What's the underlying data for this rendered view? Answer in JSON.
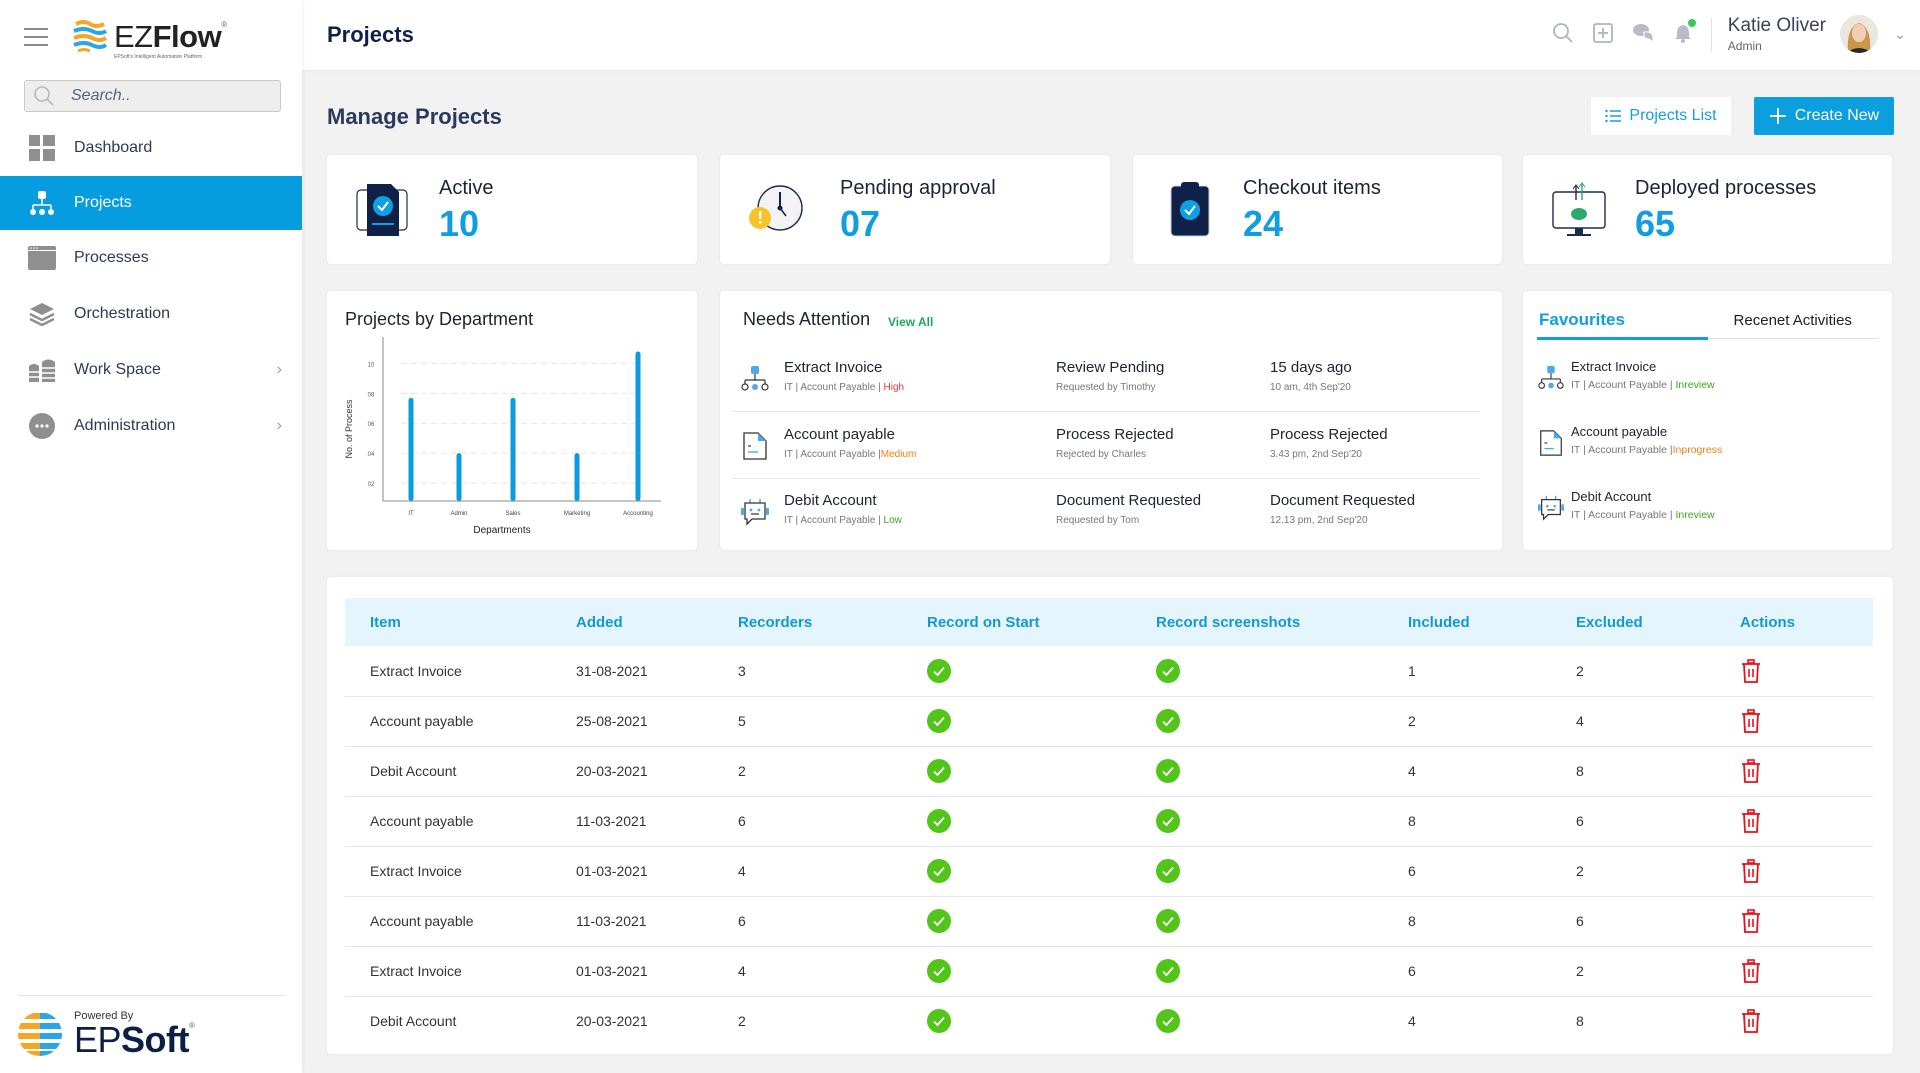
{
  "app": {
    "logo_text_light": "EZ",
    "logo_text_bold": "Flow",
    "logo_tagline": "EPSoft's Intelligent Automation Platform",
    "powered_by": "Powered By",
    "powered_brand_light": "EP",
    "powered_brand_bold": "Soft"
  },
  "sidebar": {
    "search_placeholder": "Search..",
    "items": [
      {
        "label": "Dashboard",
        "icon": "dashboard-icon",
        "active": false
      },
      {
        "label": "Projects",
        "icon": "hierarchy-icon",
        "active": true
      },
      {
        "label": "Processes",
        "icon": "browser-window-icon",
        "active": false
      },
      {
        "label": "Orchestration",
        "icon": "layers-icon",
        "active": false
      },
      {
        "label": "Work Space",
        "icon": "workspace-icon",
        "active": false,
        "has_submenu": true
      },
      {
        "label": "Administration",
        "icon": "more-circle-icon",
        "active": false,
        "has_submenu": true
      }
    ]
  },
  "header": {
    "title": "Projects",
    "icons": [
      "search-icon",
      "add-box-icon",
      "chat-icon",
      "bell-icon"
    ],
    "user_name": "Katie Oliver",
    "user_role": "Admin"
  },
  "main": {
    "section_title": "Manage Projects",
    "projects_list_label": "Projects List",
    "create_new_label": "Create New",
    "stats": [
      {
        "label": "Active",
        "value": "10"
      },
      {
        "label": "Pending approval",
        "value": "07"
      },
      {
        "label": "Checkout items",
        "value": "24"
      },
      {
        "label": "Deployed processes",
        "value": "65"
      }
    ]
  },
  "chart_data": {
    "type": "bar",
    "title": "Projects by Department",
    "xlabel": "Departments",
    "ylabel": "No. of Process",
    "categories": [
      "IT",
      "Admin",
      "Sales",
      "Marketing",
      "Accounting"
    ],
    "values": [
      7.7,
      4,
      7.7,
      4,
      10.8
    ],
    "yticks": [
      "02",
      "04",
      "06",
      "08",
      "10"
    ],
    "ytick_values": [
      2,
      4,
      6,
      8,
      10
    ],
    "ylim": [
      0.8,
      11.5
    ],
    "grid": true,
    "bar_color": "#0a9be0"
  },
  "needs_attention": {
    "title": "Needs Attention",
    "view_all": "View All",
    "items": [
      {
        "name": "Extract Invoice",
        "dept": "IT",
        "category": "Account Payable",
        "priority": "High",
        "priority_class": "pr-high",
        "status": "Review Pending",
        "by": "Requested by Timothy",
        "when": "15 days ago",
        "date": "10 am, 4th Sep'20",
        "icon": "hierarchy-icon"
      },
      {
        "name": "Account payable",
        "dept": "IT",
        "category": "Account Payable",
        "priority": "Medium",
        "priority_class": "pr-medium",
        "status": "Process Rejected",
        "by": "Rejected by Charles",
        "when": "Process Rejected",
        "date": "3.43 pm, 2nd Sep'20",
        "icon": "document-icon"
      },
      {
        "name": "Debit Account",
        "dept": "IT",
        "category": "Account Payable",
        "priority": "Low",
        "priority_class": "pr-low",
        "status": "Document Requested",
        "by": "Requested by Tom",
        "when": "Document Requested",
        "date": "12.13 pm, 2nd Sep'20",
        "icon": "bot-icon"
      }
    ]
  },
  "favourites": {
    "tabs": [
      "Favourites",
      "Recenet Activities"
    ],
    "items": [
      {
        "name": "Extract Invoice",
        "dept": "IT",
        "category": "Account Payable",
        "status": "Inreview",
        "status_class": "st-inreview",
        "icon": "hierarchy-icon"
      },
      {
        "name": "Account payable",
        "dept": "IT",
        "category": "Account Payable",
        "status": "Inprogress",
        "status_class": "st-inprogress",
        "icon": "document-icon"
      },
      {
        "name": "Debit Account",
        "dept": "IT",
        "category": "Account Payable",
        "status": "Inreview",
        "status_class": "st-inreview",
        "icon": "bot-icon"
      }
    ]
  },
  "table": {
    "columns": [
      "Item",
      "Added",
      "Recorders",
      "Record on Start",
      "Record screenshots",
      "Included",
      "Excluded",
      "Actions"
    ],
    "rows": [
      {
        "item": "Extract Invoice",
        "added": "31-08-2021",
        "recorders": "3",
        "record_on_start": true,
        "record_screenshots": true,
        "included": "1",
        "excluded": "2"
      },
      {
        "item": "Account payable",
        "added": "25-08-2021",
        "recorders": "5",
        "record_on_start": true,
        "record_screenshots": true,
        "included": "2",
        "excluded": "4"
      },
      {
        "item": "Debit Account",
        "added": "20-03-2021",
        "recorders": "2",
        "record_on_start": true,
        "record_screenshots": true,
        "included": "4",
        "excluded": "8"
      },
      {
        "item": "Account payable",
        "added": "11-03-2021",
        "recorders": "6",
        "record_on_start": true,
        "record_screenshots": true,
        "included": "8",
        "excluded": "6"
      },
      {
        "item": "Extract Invoice",
        "added": "01-03-2021",
        "recorders": "4",
        "record_on_start": true,
        "record_screenshots": true,
        "included": "6",
        "excluded": "2"
      },
      {
        "item": "Account payable",
        "added": "11-03-2021",
        "recorders": "6",
        "record_on_start": true,
        "record_screenshots": true,
        "included": "8",
        "excluded": "6"
      },
      {
        "item": "Extract Invoice",
        "added": "01-03-2021",
        "recorders": "4",
        "record_on_start": true,
        "record_screenshots": true,
        "included": "6",
        "excluded": "2"
      },
      {
        "item": "Debit Account",
        "added": "20-03-2021",
        "recorders": "2",
        "record_on_start": true,
        "record_screenshots": true,
        "included": "4",
        "excluded": "8"
      }
    ]
  },
  "colors": {
    "accent": "#0b9fe0",
    "success": "#52c41a",
    "danger": "#e8111c",
    "high": "#e53935",
    "medium": "#f07f16",
    "low": "#3aa81e"
  }
}
